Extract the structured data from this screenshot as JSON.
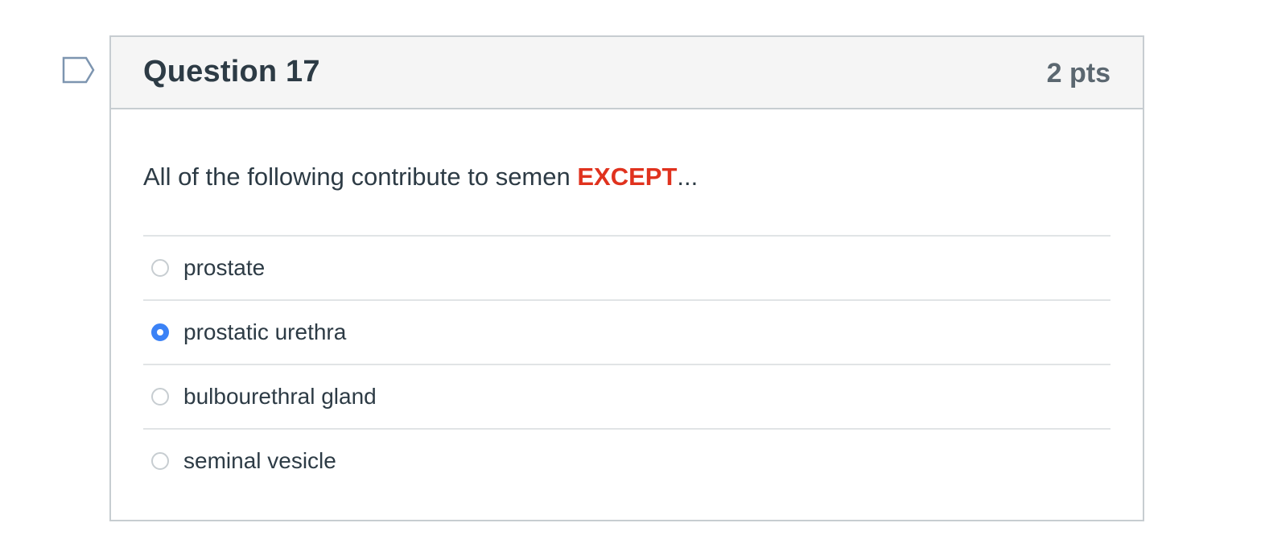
{
  "flag_icon": "flag-outline-icon",
  "question": {
    "title": "Question 17",
    "points": "2 pts",
    "text_before": "All of the following contribute to semen ",
    "text_emphasis": "EXCEPT",
    "text_after": "...",
    "emphasis_color": "#e0321e",
    "answers": [
      {
        "label": "prostate",
        "selected": false
      },
      {
        "label": "prostatic urethra",
        "selected": true
      },
      {
        "label": "bulbourethral gland",
        "selected": false
      },
      {
        "label": "seminal vesicle",
        "selected": false
      }
    ],
    "selected_color": "#3b82f6"
  }
}
